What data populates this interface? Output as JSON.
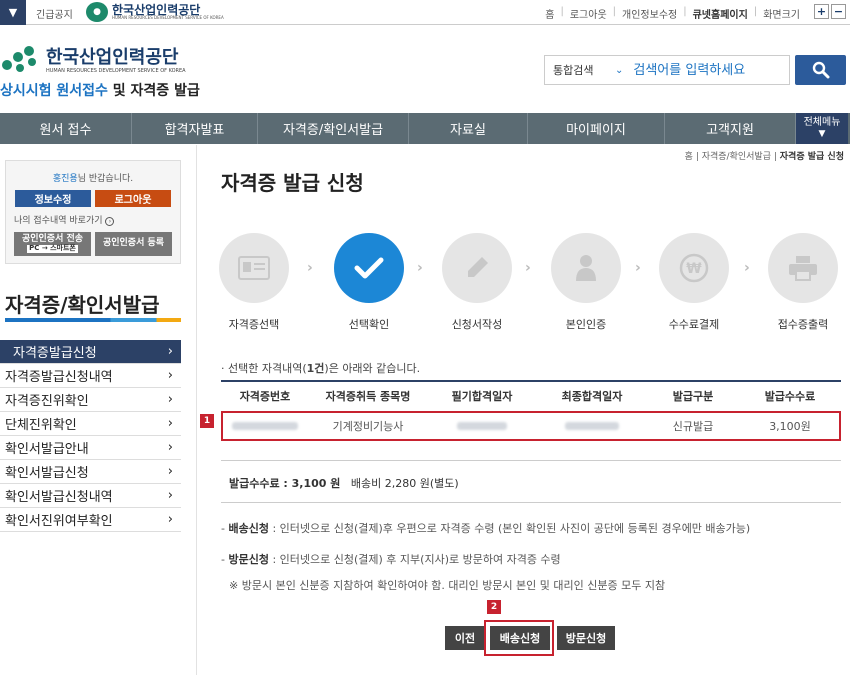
{
  "topbar": {
    "notice": "긴급공지",
    "mini_logo_ko": "한국산업인력공단",
    "mini_logo_en": "HUMAN RESOURCES DEVELOPMENT SERVICE OF KOREA",
    "links": [
      "홈",
      "로그아웃",
      "개인정보수정",
      "큐넷홈페이지",
      "화면크기"
    ],
    "zoom_in": "+",
    "zoom_out": "−"
  },
  "header": {
    "logo_ko": "한국산업인력공단",
    "logo_en": "HUMAN RESOURCES DEVELOPMENT SERVICE OF KOREA",
    "site_title_blue": "상시시험 원서접수",
    "site_title_dark": " 및 자격증 발급",
    "search_scope": "통합검색",
    "search_placeholder": "검색어를 입력하세요"
  },
  "nav": {
    "items": [
      "원서 접수",
      "합격자발표",
      "자격증/확인서발급",
      "자료실",
      "마이페이지",
      "고객지원"
    ],
    "all_menu": "전체메뉴"
  },
  "login": {
    "user_name": "홍진용",
    "welcome_suffix": "님 반갑습니다.",
    "edit_info": "정보수정",
    "logout": "로그아웃",
    "shortcut": "나의 접수내역 바로가기",
    "cert_transfer_line1": "공인인증서 전송",
    "cert_transfer_line2": "PC → 스마트폰",
    "cert_register": "공인인증서 등록"
  },
  "sidebar": {
    "title": "자격증/확인서발급",
    "items": [
      "자격증발급신청",
      "자격증발급신청내역",
      "자격증진위확인",
      "단체진위확인",
      "확인서발급안내",
      "확인서발급신청",
      "확인서발급신청내역",
      "확인서진위여부확인"
    ]
  },
  "breadcrumb": {
    "home": "홈",
    "parent": "자격증/확인서발급",
    "current": "자격증 발급 신청"
  },
  "page_title": "자격증 발급 신청",
  "steps": [
    "자격증선택",
    "선택확인",
    "신청서작성",
    "본인인증",
    "수수료결제",
    "접수증출력"
  ],
  "selected_note": {
    "prefix": "· 선택한 자격내역(",
    "count": "1건",
    "suffix": ")은 아래와 같습니다."
  },
  "table": {
    "headers": [
      "자격증번호",
      "자격증취득 종목명",
      "필기합격일자",
      "최종합격일자",
      "발급구분",
      "발급수수료"
    ],
    "row": {
      "cert_name": "기계정비기능사",
      "issue_type": "신규발급",
      "fee": "3,100원"
    }
  },
  "fee_summary": {
    "label": "발급수수료 : 3,100 원",
    "shipping": "배송비 2,280 원(별도)"
  },
  "info": {
    "delivery_label": "배송신청",
    "delivery_text": " : 인터넷으로 신청(결제)후 우편으로 자격증 수령 (본인 확인된 사진이 공단에 등록된 경우에만 배송가능)",
    "visit_label": "방문신청",
    "visit_text": " : 인터넷으로 신청(결제) 후 지부(지사)로 방문하여 자격증 수령",
    "note": "※ 방문시 본인 신분증 지참하여 확인하여야 함. 대리인 방문시 본인 및 대리인 신분증 모두 지참"
  },
  "buttons": {
    "prev": "이전",
    "delivery": "배송신청",
    "visit": "방문신청"
  },
  "annotations": [
    "1",
    "2"
  ],
  "colors": {
    "navy": "#2c4166",
    "blue": "#1c87d6",
    "highlight_red": "#c7222f",
    "nav_gray": "#5b6b73"
  }
}
